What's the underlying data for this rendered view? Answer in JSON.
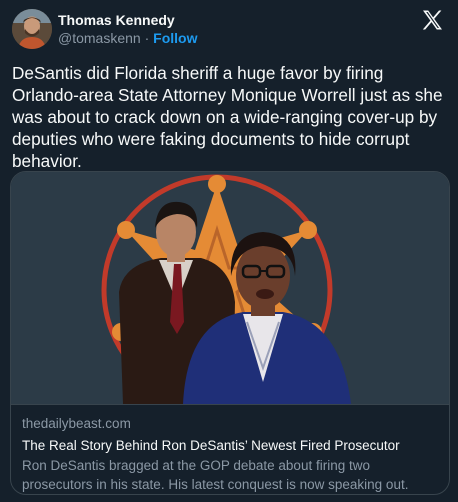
{
  "author": {
    "display_name": "Thomas Kennedy",
    "handle": "@tomaskenn",
    "separator": " · ",
    "follow_label": "Follow"
  },
  "tweet": {
    "text": "DeSantis did Florida sheriff a huge favor by firing Orlando-area State Attorney Monique Worrell just as she was about to crack down on a wide-ranging cover-up by deputies who were faking documents to hide corrupt behavior."
  },
  "link_card": {
    "domain": "thedailybeast.com",
    "title": "The Real Story Behind Ron DeSantis’ Newest Fired Prosecutor",
    "description": "Ron DeSantis bragged at the GOP debate about firing two prosecutors in his state. His latest conquest is now speaking out."
  },
  "colors": {
    "background": "#15202b",
    "accent": "#1d9bf0",
    "secondary_text": "#8b98a5",
    "card_image_bg": "#2c3b47",
    "star_orange": "#e58b35",
    "ring_red": "#c23a2a"
  },
  "icons": {
    "platform_logo": "x-logo-icon"
  }
}
